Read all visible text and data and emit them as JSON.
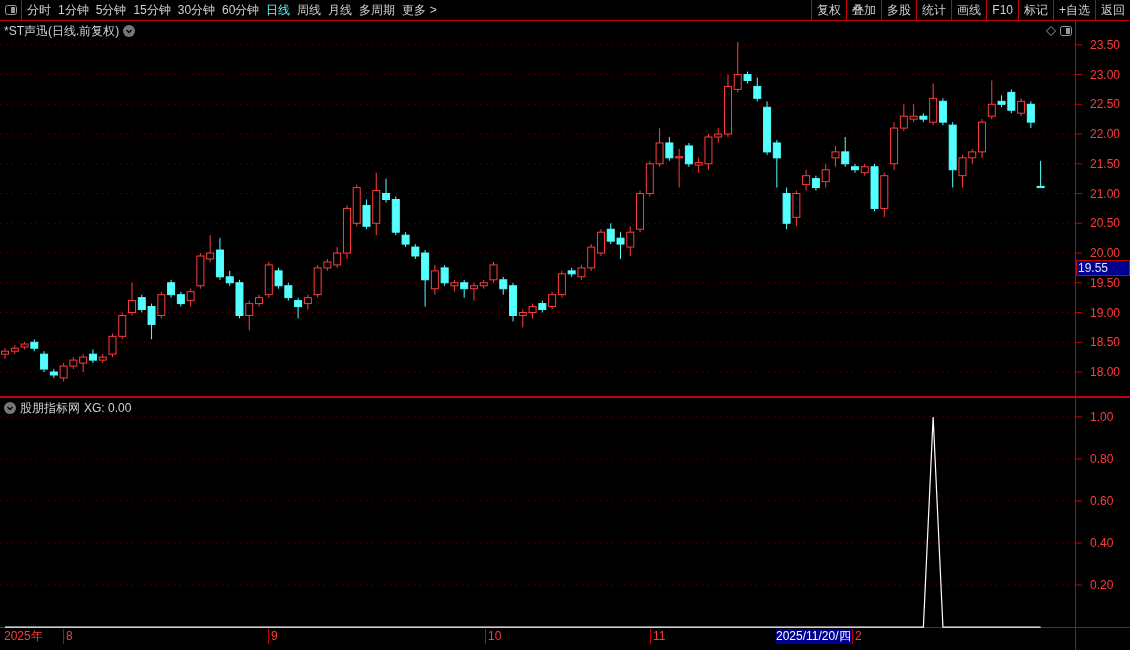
{
  "toolbar": {
    "periods": [
      {
        "label": "分时",
        "selected": false
      },
      {
        "label": "1分钟",
        "selected": false
      },
      {
        "label": "5分钟",
        "selected": false
      },
      {
        "label": "15分钟",
        "selected": false
      },
      {
        "label": "30分钟",
        "selected": false
      },
      {
        "label": "60分钟",
        "selected": false
      },
      {
        "label": "日线",
        "selected": true
      },
      {
        "label": "周线",
        "selected": false
      },
      {
        "label": "月线",
        "selected": false
      },
      {
        "label": "多周期",
        "selected": false
      },
      {
        "label": "更多 >",
        "selected": false
      }
    ],
    "buttons": [
      "复权",
      "叠加",
      "多股",
      "统计",
      "画线",
      "F10",
      "标记",
      "+自选",
      "返回"
    ]
  },
  "main_chart": {
    "title": "*ST声迅(日线.前复权)",
    "price_tag": "19.55",
    "chart_data": {
      "type": "candlestick",
      "ylim": [
        17.58,
        23.9
      ],
      "grid": true,
      "yticks": [
        {
          "value": 23.5,
          "label": "23.50"
        },
        {
          "value": 23,
          "label": "23.00"
        },
        {
          "value": 22.5,
          "label": "22.50"
        },
        {
          "value": 22,
          "label": "22.00"
        },
        {
          "value": 21.5,
          "label": "21.50"
        },
        {
          "value": 21,
          "label": "21.00"
        },
        {
          "value": 20.5,
          "label": "20.50"
        },
        {
          "value": 20,
          "label": "20.00"
        },
        {
          "value": 19.5,
          "label": "19.50"
        },
        {
          "value": 19,
          "label": "19.00"
        },
        {
          "value": 18.5,
          "label": "18.50"
        },
        {
          "value": 18,
          "label": "18.00"
        }
      ],
      "ohlc": [
        [
          18.3,
          18.4,
          18.22,
          18.35
        ],
        [
          18.35,
          18.45,
          18.3,
          18.4
        ],
        [
          18.42,
          18.5,
          18.38,
          18.47
        ],
        [
          18.5,
          18.55,
          18.35,
          18.4
        ],
        [
          18.3,
          18.35,
          18.0,
          18.05
        ],
        [
          18.0,
          18.05,
          17.9,
          17.95
        ],
        [
          17.9,
          18.15,
          17.84,
          18.1
        ],
        [
          18.1,
          18.25,
          18.05,
          18.2
        ],
        [
          18.15,
          18.3,
          18.0,
          18.25
        ],
        [
          18.3,
          18.38,
          18.15,
          18.2
        ],
        [
          18.2,
          18.3,
          18.15,
          18.25
        ],
        [
          18.3,
          18.65,
          18.25,
          18.6
        ],
        [
          18.6,
          19.0,
          18.55,
          18.95
        ],
        [
          19.0,
          19.5,
          18.95,
          19.2
        ],
        [
          19.25,
          19.3,
          19.0,
          19.05
        ],
        [
          19.1,
          19.15,
          18.55,
          18.8
        ],
        [
          18.95,
          19.35,
          18.9,
          19.3
        ],
        [
          19.5,
          19.55,
          19.25,
          19.3
        ],
        [
          19.3,
          19.35,
          19.1,
          19.15
        ],
        [
          19.2,
          19.4,
          19.1,
          19.35
        ],
        [
          19.45,
          20.0,
          19.4,
          19.95
        ],
        [
          19.9,
          20.3,
          19.85,
          20.0
        ],
        [
          20.05,
          20.25,
          19.55,
          19.6
        ],
        [
          19.6,
          19.7,
          19.45,
          19.5
        ],
        [
          19.5,
          19.55,
          18.9,
          18.95
        ],
        [
          18.95,
          19.2,
          18.7,
          19.15
        ],
        [
          19.15,
          19.3,
          19.1,
          19.25
        ],
        [
          19.3,
          19.85,
          19.25,
          19.8
        ],
        [
          19.7,
          19.75,
          19.4,
          19.45
        ],
        [
          19.45,
          19.5,
          19.2,
          19.25
        ],
        [
          19.2,
          19.25,
          18.9,
          19.1
        ],
        [
          19.15,
          19.3,
          19.05,
          19.25
        ],
        [
          19.3,
          19.8,
          19.25,
          19.75
        ],
        [
          19.75,
          19.9,
          19.7,
          19.85
        ],
        [
          19.8,
          20.1,
          19.75,
          20.0
        ],
        [
          20.0,
          20.8,
          19.9,
          20.75
        ],
        [
          20.5,
          21.15,
          20.45,
          21.1
        ],
        [
          20.8,
          20.9,
          20.4,
          20.45
        ],
        [
          20.5,
          21.35,
          20.3,
          21.05
        ],
        [
          21.0,
          21.25,
          20.85,
          20.9
        ],
        [
          20.9,
          20.95,
          20.3,
          20.35
        ],
        [
          20.3,
          20.35,
          20.1,
          20.15
        ],
        [
          20.1,
          20.15,
          19.9,
          19.95
        ],
        [
          20.0,
          20.05,
          19.1,
          19.55
        ],
        [
          19.4,
          19.8,
          19.3,
          19.7
        ],
        [
          19.75,
          19.8,
          19.45,
          19.5
        ],
        [
          19.45,
          19.55,
          19.35,
          19.5
        ],
        [
          19.5,
          19.55,
          19.25,
          19.4
        ],
        [
          19.4,
          19.5,
          19.2,
          19.45
        ],
        [
          19.45,
          19.55,
          19.4,
          19.5
        ],
        [
          19.55,
          19.85,
          19.5,
          19.8
        ],
        [
          19.55,
          19.6,
          19.3,
          19.4
        ],
        [
          19.45,
          19.5,
          18.85,
          18.95
        ],
        [
          18.95,
          19.05,
          18.75,
          19.0
        ],
        [
          19.0,
          19.15,
          18.9,
          19.1
        ],
        [
          19.15,
          19.2,
          19.0,
          19.05
        ],
        [
          19.1,
          19.35,
          19.05,
          19.3
        ],
        [
          19.3,
          19.7,
          19.25,
          19.65
        ],
        [
          19.7,
          19.75,
          19.6,
          19.65
        ],
        [
          19.6,
          19.8,
          19.55,
          19.75
        ],
        [
          19.75,
          20.15,
          19.7,
          20.1
        ],
        [
          20.0,
          20.4,
          19.95,
          20.35
        ],
        [
          20.4,
          20.5,
          20.15,
          20.2
        ],
        [
          20.25,
          20.35,
          19.9,
          20.15
        ],
        [
          20.1,
          20.45,
          19.95,
          20.35
        ],
        [
          20.4,
          21.05,
          20.35,
          21.0
        ],
        [
          21.0,
          21.55,
          20.95,
          21.5
        ],
        [
          21.5,
          22.1,
          21.45,
          21.85
        ],
        [
          21.85,
          21.95,
          21.55,
          21.6
        ],
        [
          21.6,
          21.75,
          21.1,
          21.62
        ],
        [
          21.8,
          21.85,
          21.45,
          21.5
        ],
        [
          21.48,
          21.6,
          21.35,
          21.52
        ],
        [
          21.5,
          22.0,
          21.4,
          21.95
        ],
        [
          21.95,
          22.1,
          21.85,
          22.0
        ],
        [
          22.0,
          23.0,
          21.95,
          22.8
        ],
        [
          22.75,
          23.55,
          22.7,
          23.0
        ],
        [
          23.0,
          23.05,
          22.85,
          22.9
        ],
        [
          22.8,
          22.95,
          22.55,
          22.6
        ],
        [
          22.45,
          22.55,
          21.65,
          21.7
        ],
        [
          21.85,
          21.9,
          21.1,
          21.6
        ],
        [
          21.0,
          21.1,
          20.4,
          20.5
        ],
        [
          20.6,
          21.05,
          20.45,
          21.0
        ],
        [
          21.15,
          21.4,
          21.05,
          21.3
        ],
        [
          21.25,
          21.3,
          21.05,
          21.1
        ],
        [
          21.2,
          21.5,
          21.1,
          21.4
        ],
        [
          21.6,
          21.8,
          21.45,
          21.7
        ],
        [
          21.7,
          21.95,
          21.45,
          21.5
        ],
        [
          21.45,
          21.5,
          21.35,
          21.4
        ],
        [
          21.35,
          21.5,
          21.3,
          21.45
        ],
        [
          21.45,
          21.5,
          20.7,
          20.75
        ],
        [
          20.75,
          21.35,
          20.6,
          21.3
        ],
        [
          21.5,
          22.2,
          21.4,
          22.1
        ],
        [
          22.1,
          22.5,
          22.05,
          22.3
        ],
        [
          22.25,
          22.5,
          22.2,
          22.3
        ],
        [
          22.3,
          22.35,
          22.2,
          22.25
        ],
        [
          22.2,
          22.85,
          22.15,
          22.6
        ],
        [
          22.55,
          22.6,
          22.15,
          22.2
        ],
        [
          22.15,
          22.2,
          21.1,
          21.4
        ],
        [
          21.3,
          21.65,
          21.1,
          21.6
        ],
        [
          21.6,
          21.75,
          21.5,
          21.7
        ],
        [
          21.7,
          22.25,
          21.6,
          22.2
        ],
        [
          22.3,
          22.9,
          22.25,
          22.5
        ],
        [
          22.55,
          22.65,
          22.45,
          22.5
        ],
        [
          22.7,
          22.75,
          22.35,
          22.4
        ],
        [
          22.35,
          22.6,
          22.3,
          22.55
        ],
        [
          22.5,
          22.55,
          22.1,
          22.2
        ],
        [
          21.12,
          21.55,
          21.1,
          21.1
        ]
      ]
    }
  },
  "indicator": {
    "name": "股朋指标网",
    "reading": ": 0.00",
    "chart_data": {
      "type": "line",
      "ylim": [
        -0.114,
        1.09
      ],
      "grid": true,
      "yticks": [
        {
          "value": 1,
          "label": "1.00"
        },
        {
          "value": 0.8,
          "label": "0.80"
        },
        {
          "value": 0.6,
          "label": "0.60"
        },
        {
          "value": 0.4,
          "label": "0.40"
        },
        {
          "value": 0.2,
          "label": "0.20"
        }
      ],
      "series": [
        {
          "name": "XG",
          "color": "#ffffff",
          "values": [
            0,
            0,
            0,
            0,
            0,
            0,
            0,
            0,
            0,
            0,
            0,
            0,
            0,
            0,
            0,
            0,
            0,
            0,
            0,
            0,
            0,
            0,
            0,
            0,
            0,
            0,
            0,
            0,
            0,
            0,
            0,
            0,
            0,
            0,
            0,
            0,
            0,
            0,
            0,
            0,
            0,
            0,
            0,
            0,
            0,
            0,
            0,
            0,
            0,
            0,
            0,
            0,
            0,
            0,
            0,
            0,
            0,
            0,
            0,
            0,
            0,
            0,
            0,
            0,
            0,
            0,
            0,
            0,
            0,
            0,
            0,
            0,
            0,
            0,
            0,
            0,
            0,
            0,
            0,
            0,
            0,
            0,
            0,
            0,
            0,
            0,
            0,
            0,
            0,
            0,
            0,
            0,
            0,
            0,
            0,
            1,
            0,
            0,
            0,
            0,
            0,
            0,
            0,
            0,
            0,
            0,
            0
          ]
        }
      ]
    }
  },
  "date_axis": [
    {
      "label": "2025年",
      "kind": "year"
    },
    {
      "label": "8",
      "kind": "month"
    },
    {
      "label": "9",
      "kind": "month"
    },
    {
      "label": "10",
      "kind": "month"
    },
    {
      "label": "11",
      "kind": "month"
    },
    {
      "label": "2025/11/20/四",
      "kind": "cursor"
    },
    {
      "label": "2",
      "kind": "month"
    }
  ]
}
